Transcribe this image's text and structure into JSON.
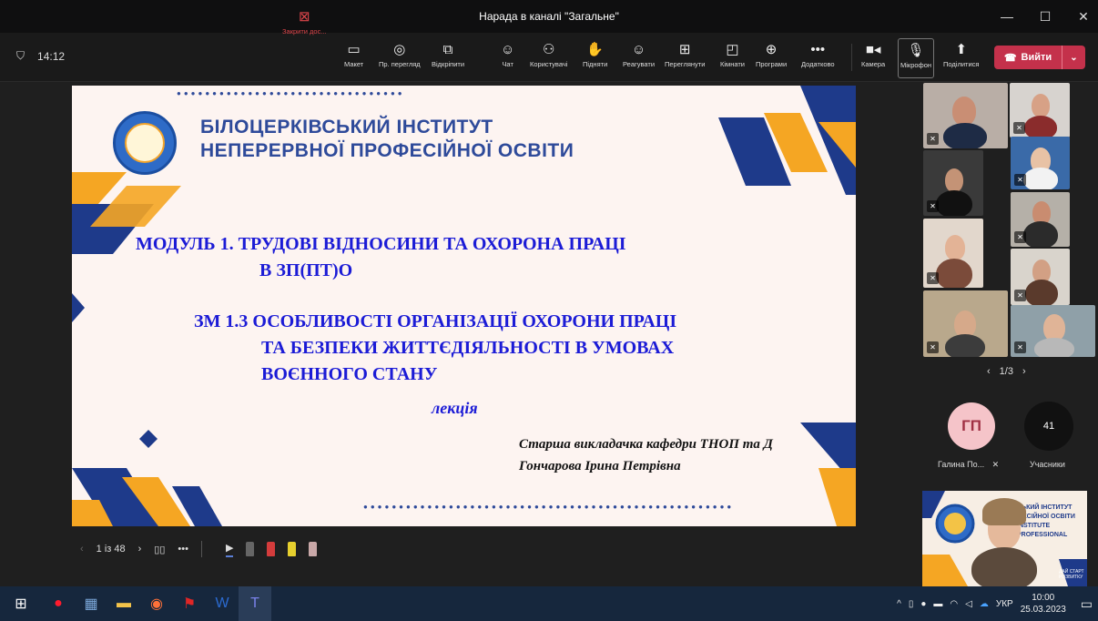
{
  "window": {
    "title": "Нарада в каналі \"Загальне\"",
    "minimize": "—",
    "maximize": "☐",
    "close": "✕"
  },
  "meeting": {
    "timer": "14:12"
  },
  "toolbar": {
    "stop_share": "Закрити дос...",
    "layout": "Макет",
    "preview": "Пр. перегляд",
    "popout": "Відкріпити",
    "chat": "Чат",
    "people": "Користувачі",
    "raise": "Підняти",
    "react": "Реагувати",
    "view": "Переглянути",
    "rooms": "Кімнати",
    "apps": "Програми",
    "more": "Додатково",
    "camera": "Камера",
    "mic": "Мікрофон",
    "share": "Поділитися",
    "leave": "Вийти"
  },
  "slide": {
    "header_line1": "БІЛОЦЕРКІВСЬКИЙ ІНСТИТУТ",
    "header_line2": "НЕПЕРЕРВНОЇ ПРОФЕСІЙНОЇ ОСВІТИ",
    "module_line1": "МОДУЛЬ 1. ТРУДОВІ ВІДНОСИНИ ТА ОХОРОНА ПРАЦІ",
    "module_line2": "В ЗП(ПТ)О",
    "sub_line1": "ЗМ 1.3 ОСОБЛИВОСТІ ОРГАНІЗАЦІЇ ОХОРОНИ ПРАЦІ",
    "sub_line2": "ТА БЕЗПЕКИ ЖИТТЄДІЯЛЬНОСТІ В УМОВАХ",
    "sub_line3": "ВОЄННОГО СТАНУ",
    "lecture": "лекція",
    "author_line1": "Старша викладачка кафедри ТНОП та Д",
    "author_line2": "Гончарова Ірина Петрівна"
  },
  "slide_nav": {
    "page": "1 із 48"
  },
  "gallery": {
    "pager": "1/3"
  },
  "participants": {
    "gp_initials": "ГП",
    "gp_name": "Галина По...",
    "count": "41",
    "count_label": "Учасники"
  },
  "speaker_slide": {
    "line1": "СЬКИЙ ІНСТИТУТ",
    "line2": "ФЕСІЙНОЇ ОСВІТИ",
    "line3": "INSTITUTE",
    "line4": "PROFESSIONAL",
    "line5": "ДАЙ СТАРТ",
    "line6": "РОЗВИТКУ"
  },
  "taskbar": {
    "lang": "УКР",
    "time": "10:00",
    "date": "25.03.2023"
  },
  "colors": {
    "accent_red": "#c4314b",
    "slide_blue": "#1b1bd6",
    "header_blue": "#2e4a9a",
    "orange": "#f5a623",
    "navy": "#1e3a8a"
  }
}
